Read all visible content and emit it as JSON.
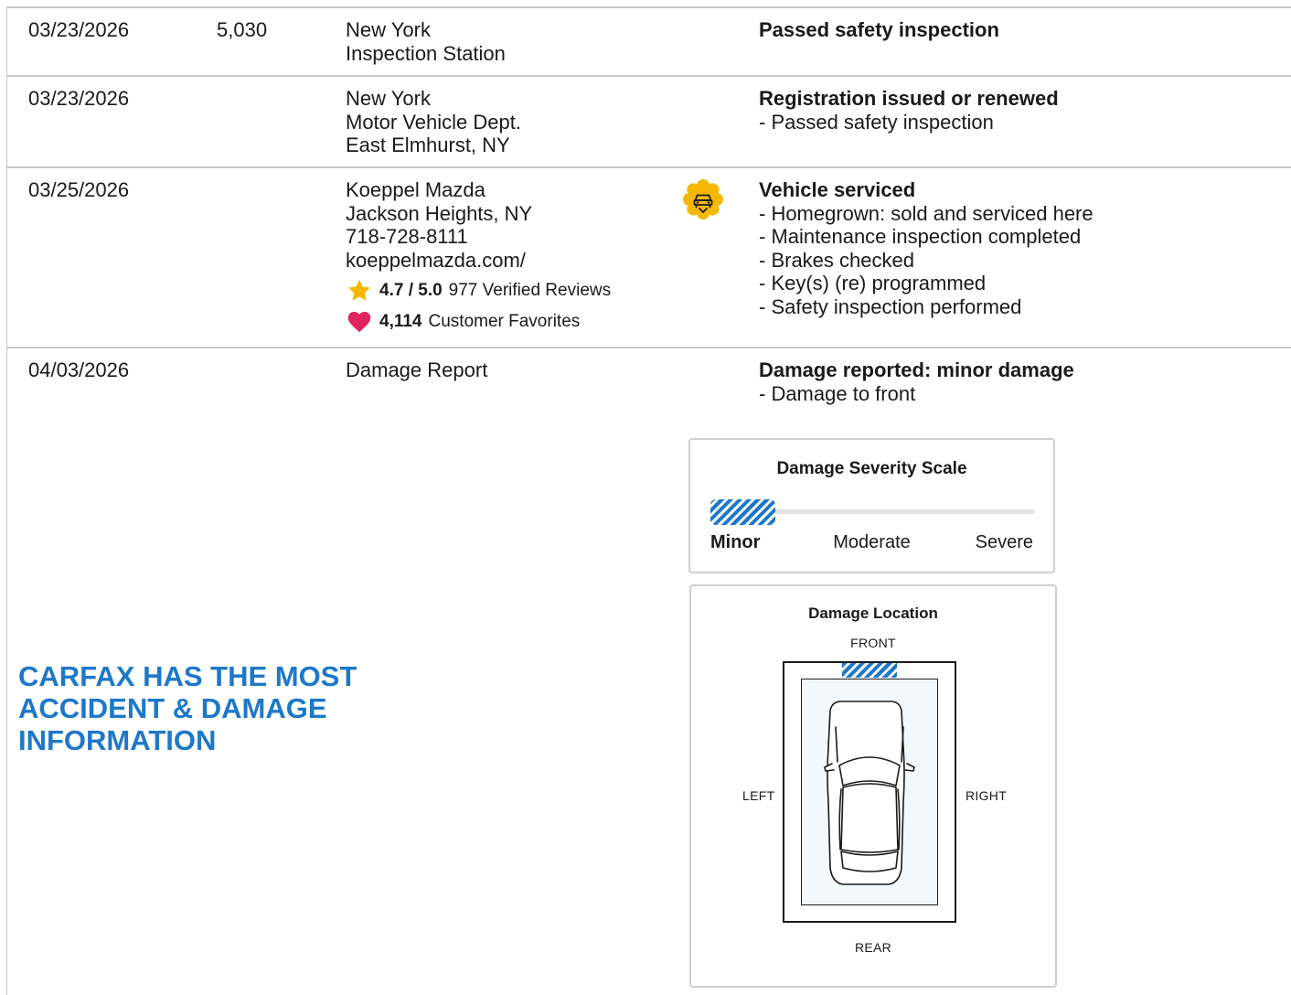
{
  "records": [
    {
      "date": "03/23/2026",
      "odometer": "5,030",
      "source": [
        "New York",
        "Inspection Station"
      ],
      "title": "Passed safety inspection",
      "details": []
    },
    {
      "date": "03/23/2026",
      "odometer": "",
      "source": [
        "New York",
        "Motor Vehicle Dept.",
        "East Elmhurst, NY"
      ],
      "title": "Registration issued or renewed",
      "details": [
        "- Passed safety inspection"
      ]
    },
    {
      "date": "03/25/2026",
      "odometer": "",
      "source": [
        "Koeppel Mazda",
        "Jackson Heights, NY",
        "718-728-8111",
        "koeppelmazda.com/"
      ],
      "rating": "4.7 / 5.0",
      "reviews": "977 Verified Reviews",
      "favorites_count": "4,114",
      "favorites_label": "Customer Favorites",
      "icon": "service-badge-icon",
      "title": "Vehicle serviced",
      "details": [
        "- Homegrown: sold and serviced here",
        "- Maintenance inspection completed",
        "- Brakes checked",
        "- Key(s) (re) programmed",
        "- Safety inspection performed"
      ]
    },
    {
      "date": "04/03/2026",
      "odometer": "",
      "source": [
        "Damage Report"
      ],
      "title": "Damage reported: minor damage",
      "details": [
        "- Damage to front"
      ]
    }
  ],
  "promo": {
    "line1": "CARFAX HAS THE MOST",
    "line2": "ACCIDENT & DAMAGE",
    "line3": "INFORMATION"
  },
  "severity": {
    "title": "Damage Severity Scale",
    "labels": [
      "Minor",
      "Moderate",
      "Severe"
    ],
    "level_fraction": 0.2
  },
  "location": {
    "title": "Damage Location",
    "front": "FRONT",
    "rear": "REAR",
    "left": "LEFT",
    "right": "RIGHT",
    "damaged_zone": "front"
  },
  "colors": {
    "accent_blue": "#1e78c8",
    "star": "#f5b800",
    "heart": "#e0245e",
    "badge": "#f5b800",
    "rule": "#c8c8c8"
  }
}
